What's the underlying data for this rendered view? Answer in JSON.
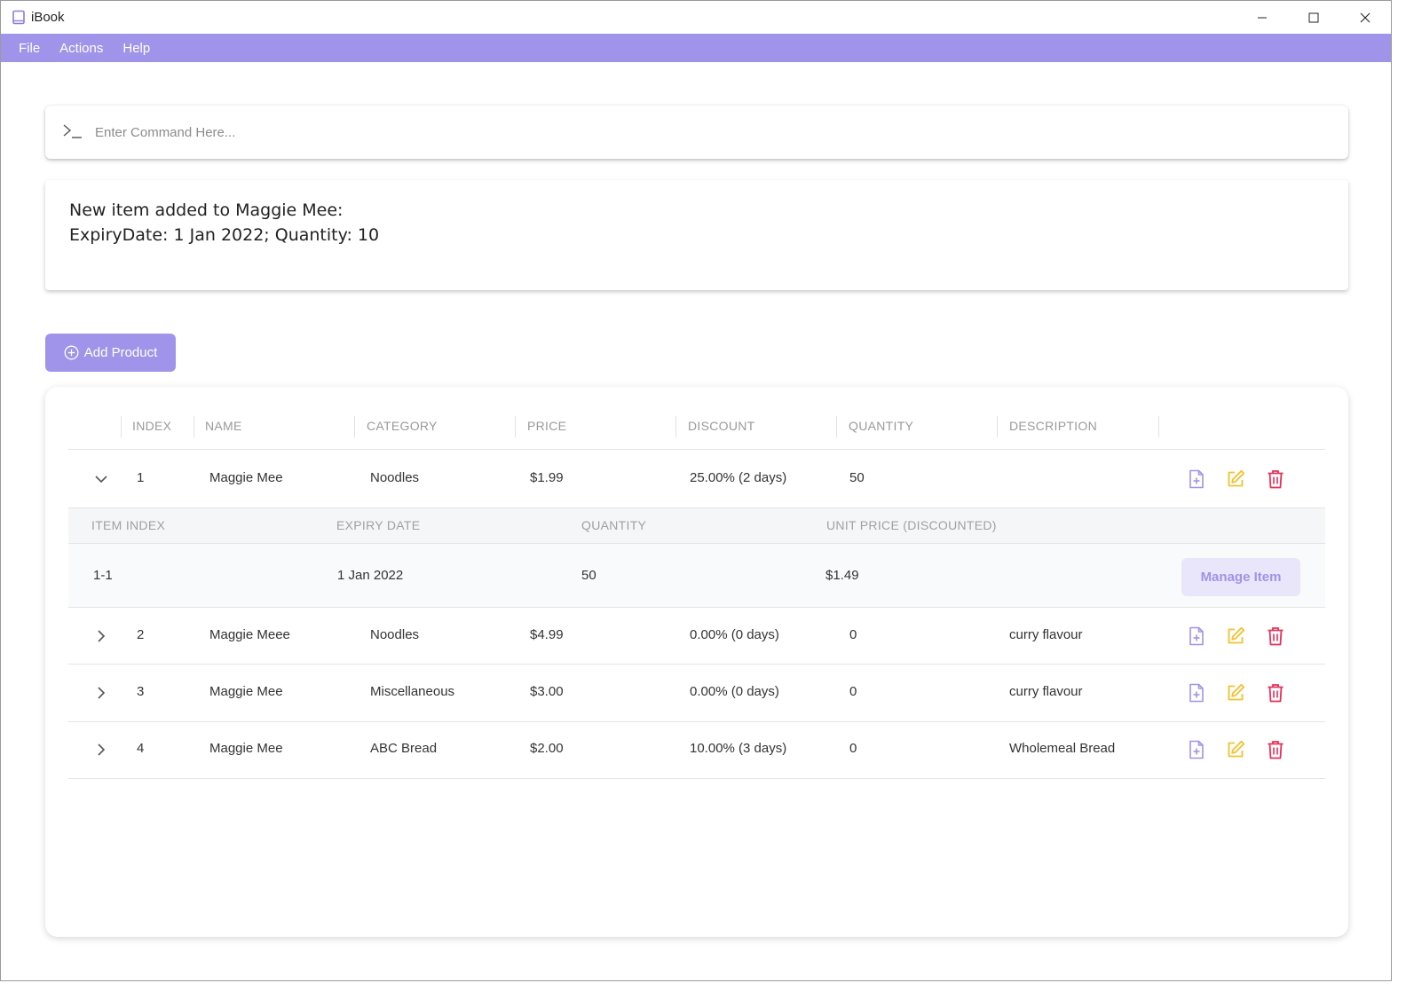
{
  "window": {
    "title": "iBook",
    "icon": "book-icon"
  },
  "menu": {
    "file": "File",
    "actions": "Actions",
    "help": "Help"
  },
  "command": {
    "placeholder": "Enter Command Here...",
    "value": ""
  },
  "result": {
    "line1": "New item added to Maggie Mee:",
    "line2": "ExpiryDate: 1 Jan 2022; Quantity: 10"
  },
  "add_product_label": "Add Product",
  "table": {
    "headers": {
      "index": "INDEX",
      "name": "NAME",
      "category": "CATEGORY",
      "price": "PRICE",
      "discount": "DISCOUNT",
      "quantity": "QUANTITY",
      "description": "DESCRIPTION"
    },
    "rows": [
      {
        "index": "1",
        "name": "Maggie Mee",
        "category": "Noodles",
        "price": "$1.99",
        "discount": "25.00% (2 days)",
        "quantity": "50",
        "description": "",
        "expanded": true
      },
      {
        "index": "2",
        "name": "Maggie Meee",
        "category": "Noodles",
        "price": "$4.99",
        "discount": "0.00% (0 days)",
        "quantity": "0",
        "description": "curry flavour",
        "expanded": false
      },
      {
        "index": "3",
        "name": "Maggie Mee",
        "category": "Miscellaneous",
        "price": "$3.00",
        "discount": "0.00% (0 days)",
        "quantity": "0",
        "description": "curry flavour",
        "expanded": false
      },
      {
        "index": "4",
        "name": "Maggie Mee",
        "category": "ABC Bread",
        "price": "$2.00",
        "discount": "10.00% (3 days)",
        "quantity": "0",
        "description": "Wholemeal Bread",
        "expanded": false
      }
    ],
    "sub_headers": {
      "item_index": "ITEM INDEX",
      "expiry_date": "EXPIRY DATE",
      "quantity": "QUANTITY",
      "unit_price": "UNIT PRICE (DISCOUNTED)"
    },
    "sub_rows": [
      {
        "item_index": "1-1",
        "expiry_date": "1 Jan 2022",
        "quantity": "50",
        "unit_price": "$1.49"
      }
    ],
    "manage_item_label": "Manage Item"
  },
  "colors": {
    "accent": "#a094ea",
    "edit": "#f2c230",
    "delete": "#e8315a"
  }
}
